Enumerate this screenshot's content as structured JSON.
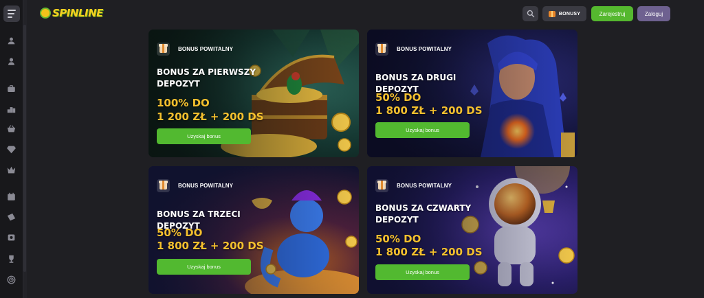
{
  "header": {
    "logo_text": "SPINLINE",
    "bonus_label": "BONUSY",
    "register_label": "Zarejestruj",
    "login_label": "Zaloguj"
  },
  "sidebar": {
    "icons": [
      "user-group-icon",
      "user-icon",
      "briefcase-icon",
      "podium-icon",
      "basket-icon",
      "diamond-icon",
      "crown-icon",
      "calendar-icon",
      "ticket-icon",
      "pack-icon",
      "trophy-icon",
      "target-icon"
    ]
  },
  "cards": [
    {
      "badge": "BONUS POWITALNY",
      "title": "BONUS ZA PIERWSZY DEPOZYT",
      "amount_line1": "100% DO",
      "amount_line2": "1 200 ZŁ + 200 DS",
      "cta": "Uzyskaj bonus",
      "theme": "treasure-chest"
    },
    {
      "badge": "BONUS POWITALNY",
      "title": "BONUS ZA DRUGI DEPOZYT",
      "amount_line1": "50% DO",
      "amount_line2": "1 800 ZŁ + 200 DS",
      "cta": "Uzyskaj bonus",
      "theme": "sorceress"
    },
    {
      "badge": "BONUS POWITALNY",
      "title": "BONUS ZA TRZECI DEPOZYT",
      "amount_line1": "50% DO",
      "amount_line2": "1 800 ZŁ + 200 DS",
      "cta": "Uzyskaj bonus",
      "theme": "genie"
    },
    {
      "badge": "BONUS POWITALNY",
      "title": "BONUS ZA CZWARTY DEPOZYT",
      "amount_line1": "50% DO",
      "amount_line2": "1 800 ZŁ + 200 DS",
      "cta": "Uzyskaj bonus",
      "theme": "astronaut"
    }
  ],
  "colors": {
    "page_bg": "#1f1f23",
    "sidebar_bg": "#18181b",
    "accent_green": "#55b82f",
    "login_purple": "#6e6190",
    "amount_gold": "#f4c02e"
  }
}
